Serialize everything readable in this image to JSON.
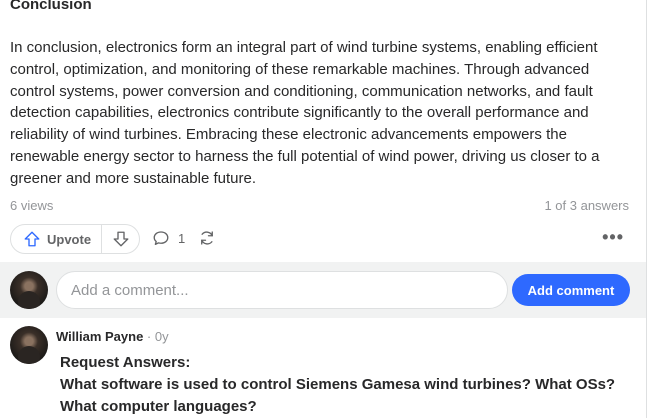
{
  "answer": {
    "section_title": "Conclusion",
    "body": "In conclusion, electronics form an integral part of wind turbine systems, enabling efficient control, optimization, and monitoring of these remarkable machines. Through advanced control systems, power conversion and conditioning, communication networks, and fault detection capabilities, electronics contribute significantly to the overall performance and reliability of wind turbines. Embracing these electronic advancements empowers the renewable energy sector to harness the full potential of wind power, driving us closer to a greener and more sustainable future.",
    "views": "6 views",
    "answers_count": "1 of 3 answers"
  },
  "actions": {
    "upvote_label": "Upvote",
    "comment_count": "1",
    "more_label": "•••"
  },
  "comment_box": {
    "placeholder": "Add a comment...",
    "button_label": "Add comment",
    "accent_color": "#2e69ff"
  },
  "comment": {
    "author": "William Payne",
    "separator": " · ",
    "time": "0y",
    "text_line1": "Request Answers:",
    "text_line2": "What software is used to control Siemens Gamesa wind turbines? What OSs? What computer languages?"
  },
  "icons": [
    "upvote-arrow-icon",
    "downvote-arrow-icon",
    "comment-bubble-icon",
    "share-reload-icon",
    "more-dots-icon"
  ]
}
